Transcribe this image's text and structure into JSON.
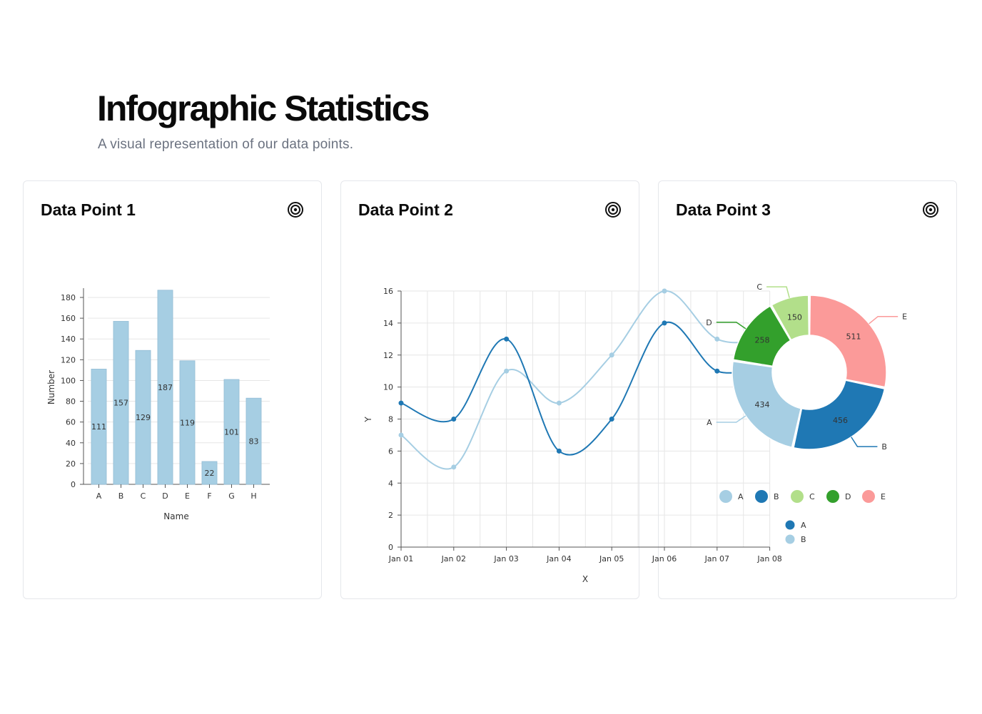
{
  "header": {
    "title": "Infographic Statistics",
    "subtitle": "A visual representation of our data points."
  },
  "cards": [
    {
      "title": "Data Point 1",
      "icon": "target-icon"
    },
    {
      "title": "Data Point 2",
      "icon": "target-icon"
    },
    {
      "title": "Data Point 3",
      "icon": "target-icon"
    }
  ],
  "chart_data": [
    {
      "type": "bar",
      "categories": [
        "A",
        "B",
        "C",
        "D",
        "E",
        "F",
        "G",
        "H"
      ],
      "values": [
        111,
        157,
        129,
        187,
        119,
        22,
        101,
        83
      ],
      "xlabel": "Name",
      "ylabel": "Number",
      "ylim": [
        0,
        180
      ],
      "yticks": [
        0,
        20,
        40,
        60,
        80,
        100,
        120,
        140,
        160,
        180
      ],
      "grid": true,
      "color": "#a6cee3"
    },
    {
      "type": "line",
      "x": [
        "Jan 01",
        "Jan 02",
        "Jan 03",
        "Jan 04",
        "Jan 05",
        "Jan 06",
        "Jan 07",
        "Jan 08"
      ],
      "series": [
        {
          "name": "A",
          "values": [
            9,
            8,
            13,
            6,
            8,
            14,
            11,
            11.5
          ],
          "color": "#1f78b4"
        },
        {
          "name": "B",
          "values": [
            7,
            5,
            11,
            9,
            12,
            16,
            13,
            13
          ],
          "color": "#a6cee3"
        }
      ],
      "xlabel": "X",
      "ylabel": "Y",
      "ylim": [
        0,
        16
      ],
      "yticks": [
        0,
        2,
        4,
        6,
        8,
        10,
        12,
        14,
        16
      ],
      "grid": true,
      "legend": "bottom-right"
    },
    {
      "type": "pie",
      "donut": true,
      "labels": [
        "A",
        "B",
        "C",
        "D",
        "E"
      ],
      "values": [
        434,
        456,
        150,
        258,
        511
      ],
      "colors": [
        "#a6cee3",
        "#1f78b4",
        "#b2df8a",
        "#33a02c",
        "#fb9a99"
      ],
      "legend": "bottom"
    }
  ]
}
